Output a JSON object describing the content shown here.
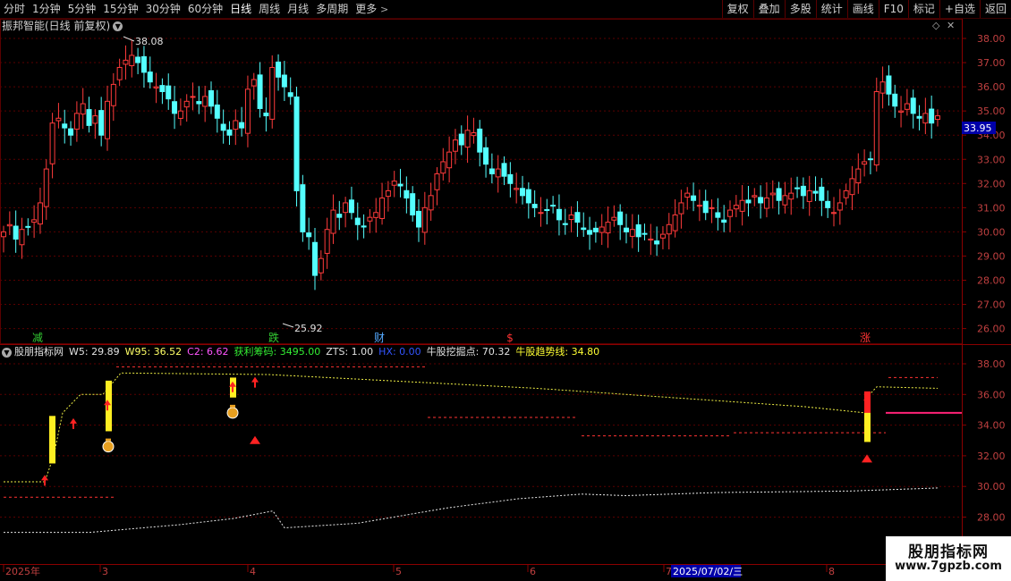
{
  "toolbar": {
    "periods": [
      "分时",
      "1分钟",
      "5分钟",
      "15分钟",
      "30分钟",
      "60分钟",
      "日线",
      "周线",
      "月线",
      "多周期"
    ],
    "active_period": "日线",
    "more_label": "更多",
    "right_buttons": [
      "复权",
      "叠加",
      "多股",
      "统计",
      "画线",
      "F10",
      "标记",
      "+自选",
      "返回"
    ]
  },
  "main_chart": {
    "title": "振邦智能(日线 前复权)",
    "high_label": "38.08",
    "low_label": "25.92",
    "current_price": "33.95",
    "y_ticks": [
      "38.00",
      "37.00",
      "36.00",
      "35.00",
      "34.00",
      "33.00",
      "32.00",
      "31.00",
      "30.00",
      "29.00",
      "28.00",
      "27.00",
      "26.00"
    ],
    "event_markers": [
      {
        "text": "减",
        "color": "#33cc33"
      },
      {
        "text": "跌",
        "color": "#33cc33"
      },
      {
        "text": "财",
        "color": "#55aaff"
      },
      {
        "text": "$",
        "color": "#ff3333"
      },
      {
        "text": "涨",
        "color": "#ff3333"
      }
    ],
    "colors": {
      "up": "#ff3b3b",
      "down": "#54ffff",
      "grid": "#5a0000"
    }
  },
  "indicator": {
    "name": "股朋指标网",
    "items": [
      {
        "label": "W5: 29.89",
        "color": "#e0e0e0"
      },
      {
        "label": "W95: 36.52",
        "color": "#ffff66"
      },
      {
        "label": "C2: 6.62",
        "color": "#ff55ff"
      },
      {
        "label": "获利筹码: 3495.00",
        "color": "#33ee33"
      },
      {
        "label": "ZTS: 1.00",
        "color": "#e0e0e0"
      },
      {
        "label": "HX: 0.00",
        "color": "#3355ff"
      },
      {
        "label": "牛股挖掘点: 70.32",
        "color": "#e0e0e0"
      },
      {
        "label": "牛股趋势线: 34.80",
        "color": "#ffff33"
      }
    ],
    "y_ticks": [
      "38.00",
      "36.00",
      "34.00",
      "32.00",
      "30.00",
      "28.00"
    ]
  },
  "time_axis": {
    "labels": [
      "2025年",
      "3",
      "4",
      "5",
      "6",
      "7",
      "8"
    ],
    "cursor_date": "2025/07/02/三"
  },
  "watermark": {
    "line1": "股朋指标网",
    "line2": "www.7gpzb.com"
  }
}
